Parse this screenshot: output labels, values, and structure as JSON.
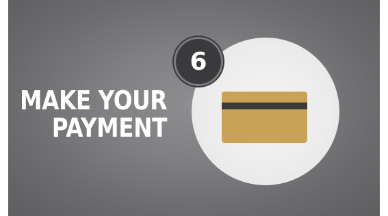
{
  "headline": {
    "line1": "MAKE YOUR",
    "line2": "PAYMENT"
  },
  "step": {
    "number": "6"
  },
  "icon": {
    "name": "credit-card-icon"
  },
  "colors": {
    "background": "#808083",
    "circle": "#ececec",
    "badge": "#3a3a3c",
    "card": "#c8a357",
    "stripe": "#3c3a37",
    "text": "#ffffff"
  }
}
